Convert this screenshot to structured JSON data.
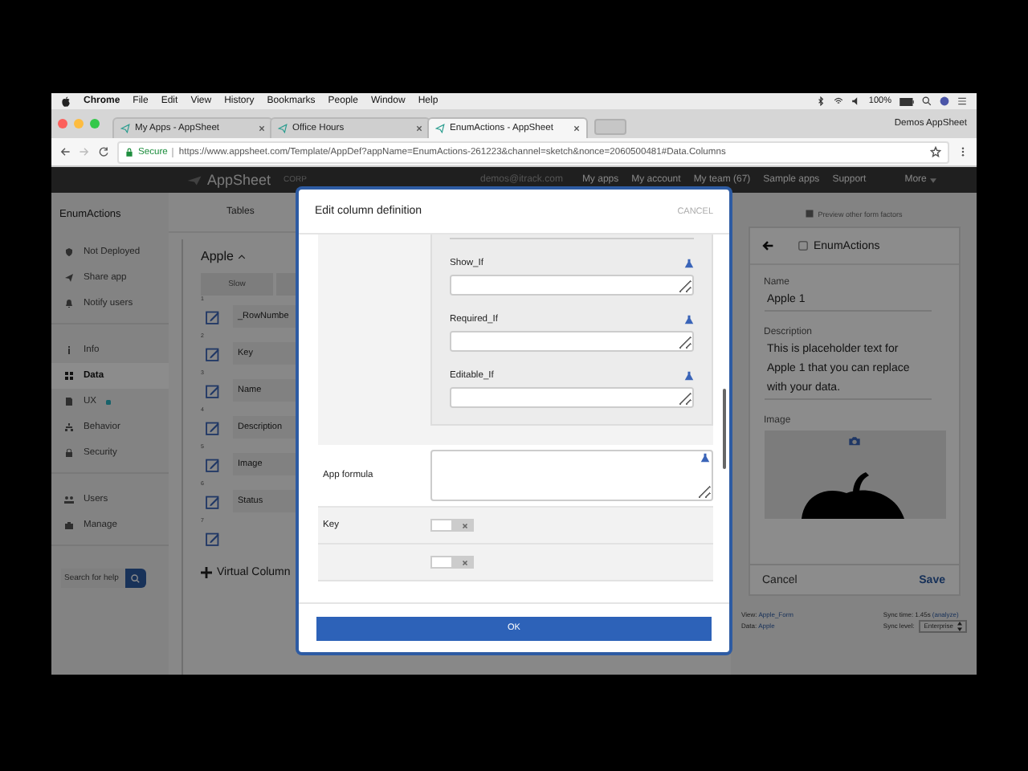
{
  "menubar": {
    "app": "Chrome",
    "menus": [
      "File",
      "Edit",
      "View",
      "History",
      "Bookmarks",
      "People",
      "Window",
      "Help"
    ],
    "battery": "100%"
  },
  "tabs": [
    {
      "title": "My Apps - AppSheet",
      "selected": false
    },
    {
      "title": "Office Hours",
      "selected": false
    },
    {
      "title": "EnumActions - AppSheet",
      "selected": true
    }
  ],
  "profile": "Demos AppSheet",
  "address": {
    "secure": "Secure",
    "url": "https://www.appsheet.com/Template/AppDef?appName=EnumActions-261223&channel=sketch&nonce=2060500481#Data.Columns"
  },
  "header": {
    "logo": "AppSheet",
    "plan": "CORP",
    "email": "demos@itrack.com",
    "links": [
      "My apps",
      "My account",
      "My team (67)",
      "Sample apps",
      "Support"
    ],
    "more": "More"
  },
  "sidebar": {
    "app_name": "EnumActions",
    "groups": [
      [
        {
          "label": "Not Deployed",
          "kind": "deploy",
          "selected": false
        },
        {
          "label": "Share app",
          "kind": "share",
          "selected": false
        },
        {
          "label": "Notify users",
          "kind": "notify",
          "selected": false
        }
      ],
      [
        {
          "label": "Info",
          "kind": "info",
          "selected": false
        },
        {
          "label": "Data",
          "kind": "data",
          "selected": true
        },
        {
          "label": "UX",
          "kind": "ux",
          "selected": false,
          "color": "#18626a"
        },
        {
          "label": "Behavior",
          "kind": "behavior",
          "selected": false
        },
        {
          "label": "Security",
          "kind": "security",
          "selected": false
        }
      ],
      [
        {
          "label": "Users",
          "kind": "users",
          "selected": false
        },
        {
          "label": "Manage",
          "kind": "manage",
          "selected": false
        }
      ]
    ],
    "search": {
      "placeholder": "Search for help"
    }
  },
  "tables": {
    "tab": "Tables",
    "table": "Apple",
    "view_button": "Slow",
    "columns": [
      {
        "number": "1",
        "name": "_RowNumbe"
      },
      {
        "number": "2",
        "name": "Key"
      },
      {
        "number": "3",
        "name": "Name"
      },
      {
        "number": "4",
        "name": "Description"
      },
      {
        "number": "5",
        "name": "Image"
      },
      {
        "number": "6",
        "name": "Status"
      },
      {
        "number": "7"
      }
    ],
    "add_virtual": "Virtual Column"
  },
  "dialog": {
    "title": "Edit column definition",
    "cancel": "CANCEL",
    "conditions": [
      {
        "label": "Show_If"
      },
      {
        "label": "Required_If"
      },
      {
        "label": "Editable_If"
      }
    ],
    "formula_label": "App formula",
    "toggles": [
      {
        "label": "Key",
        "checked": false
      },
      {
        "checked": false
      }
    ],
    "ok": "OK"
  },
  "preview": {
    "form_factors": "Preview other form factors",
    "app_title": "EnumActions",
    "fields": [
      {
        "label": "Name",
        "value": "Apple 1"
      },
      {
        "label": "Description",
        "value": "This is placeholder text for Apple 1 that you can replace with your data."
      }
    ],
    "image_label": "Image",
    "cancel": "Cancel",
    "save": "Save",
    "footer_left": [
      {
        "label": "View:",
        "value": "Apple_Form"
      },
      {
        "label": "Data:",
        "value": "Apple"
      }
    ],
    "sync_time": {
      "label": "Sync time:",
      "value": "1.45s",
      "link": "(analyze)"
    },
    "sync_level": {
      "label": "Sync level:",
      "value": "Enterprise"
    }
  }
}
